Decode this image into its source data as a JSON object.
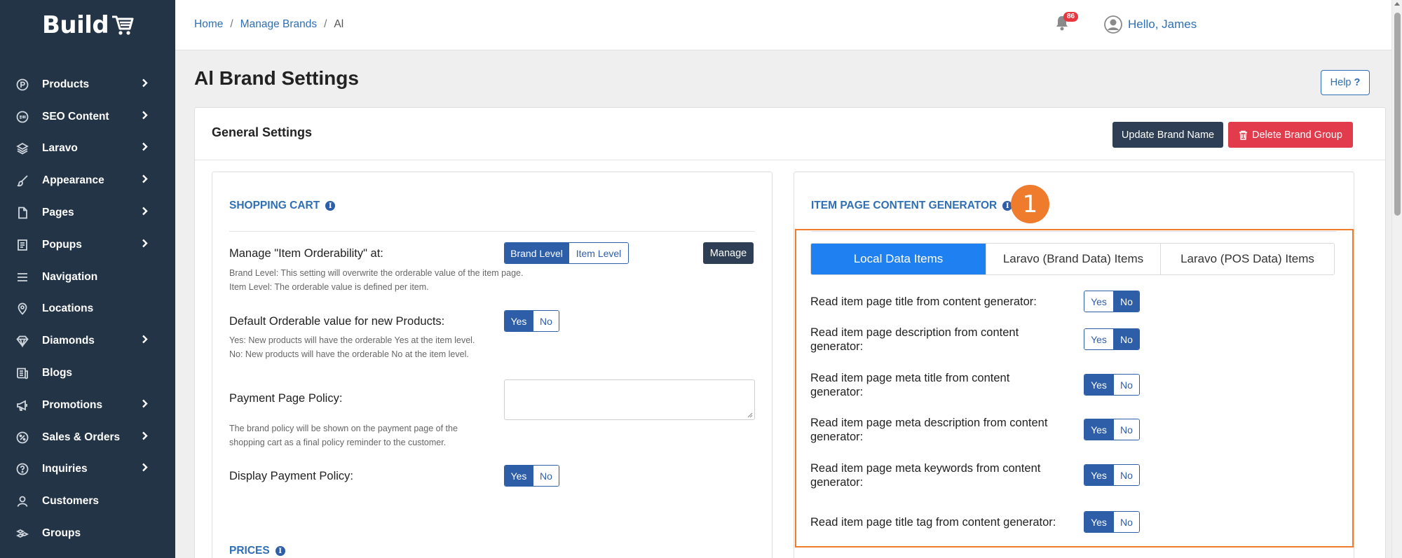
{
  "brand": {
    "logo_text": "Build"
  },
  "sidebar": {
    "items": [
      {
        "label": "Products",
        "icon": "products-icon",
        "has_children": true
      },
      {
        "label": "SEO Content",
        "icon": "seo-icon",
        "has_children": true
      },
      {
        "label": "Laravo",
        "icon": "layers-icon",
        "has_children": true
      },
      {
        "label": "Appearance",
        "icon": "brush-icon",
        "has_children": true
      },
      {
        "label": "Pages",
        "icon": "page-icon",
        "has_children": true
      },
      {
        "label": "Popups",
        "icon": "popup-icon",
        "has_children": true
      },
      {
        "label": "Navigation",
        "icon": "menu-icon",
        "has_children": false
      },
      {
        "label": "Locations",
        "icon": "map-pin-icon",
        "has_children": false
      },
      {
        "label": "Diamonds",
        "icon": "diamond-icon",
        "has_children": true
      },
      {
        "label": "Blogs",
        "icon": "newspaper-icon",
        "has_children": false
      },
      {
        "label": "Promotions",
        "icon": "megaphone-icon",
        "has_children": true
      },
      {
        "label": "Sales & Orders",
        "icon": "percent-icon",
        "has_children": true
      },
      {
        "label": "Inquiries",
        "icon": "question-icon",
        "has_children": true
      },
      {
        "label": "Customers",
        "icon": "user-icon",
        "has_children": false
      },
      {
        "label": "Groups",
        "icon": "group-icon",
        "has_children": false
      }
    ]
  },
  "topbar": {
    "breadcrumb": [
      "Home",
      "Manage Brands",
      "Al"
    ],
    "notifications_count": "86",
    "greeting": "Hello, James"
  },
  "page": {
    "title": "Al Brand Settings",
    "help_label": "Help"
  },
  "general": {
    "title": "General Settings",
    "update_button": "Update Brand Name",
    "delete_button": "Delete Brand Group"
  },
  "shopping_cart": {
    "heading": "SHOPPING CART",
    "orderability_label": "Manage \"Item Orderability\" at:",
    "orderability_options": [
      "Brand Level",
      "Item Level"
    ],
    "orderability_selected": "Brand Level",
    "manage_button": "Manage",
    "orderability_help_1": "Brand Level: This setting will overwrite the orderable value of the item page.",
    "orderability_help_2": "Item Level: The orderable value is defined per item.",
    "default_orderable_label": "Default Orderable value for new Products:",
    "default_orderable_selected": "Yes",
    "default_help_1": "Yes: New products will have the orderable Yes at the item level.",
    "default_help_2": "No: New products will have the orderable No at the item level.",
    "payment_policy_label": "Payment Page Policy:",
    "payment_policy_value": "",
    "payment_help_1": "The brand policy will be shown on the payment page of the",
    "payment_help_2": "shopping cart as a final policy reminder to the customer.",
    "display_policy_label": "Display Payment Policy:",
    "display_policy_selected": "Yes"
  },
  "prices": {
    "heading": "PRICES"
  },
  "content_generator": {
    "heading": "ITEM PAGE CONTENT GENERATOR",
    "callout_number": "1",
    "tabs": [
      "Local Data Items",
      "Laravo (Brand Data) Items",
      "Laravo (POS Data) Items"
    ],
    "active_tab": "Local Data Items",
    "rows": [
      {
        "label": "Read item page title from content generator:",
        "selected": "No"
      },
      {
        "label": "Read item page description from content generator:",
        "selected": "No"
      },
      {
        "label": "Read item page meta title from content generator:",
        "selected": "Yes"
      },
      {
        "label": "Read item page meta description from content generator:",
        "selected": "Yes"
      },
      {
        "label": "Read item page meta keywords from content generator:",
        "selected": "Yes"
      },
      {
        "label": "Read item page title tag from content generator:",
        "selected": "Yes"
      }
    ]
  },
  "yes_no": {
    "yes": "Yes",
    "no": "No"
  },
  "colors": {
    "sidebar_bg": "#243447",
    "accent_blue": "#2f5ea8",
    "danger": "#e23c4c",
    "callout_orange": "#ef7b2d",
    "active_tab": "#1f80f2"
  }
}
